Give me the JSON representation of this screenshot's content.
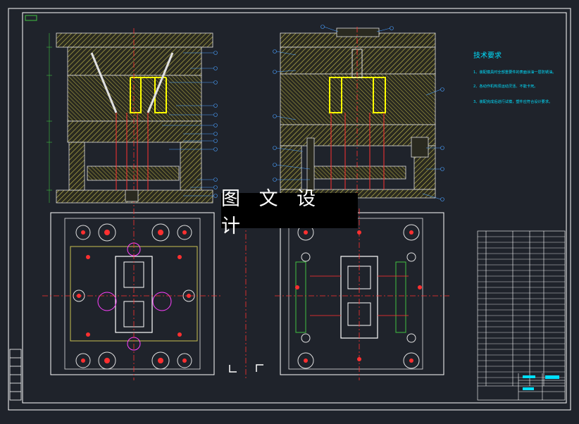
{
  "watermark": {
    "text": "图 文 设 计"
  },
  "tech_requirements": {
    "title": "技术要求",
    "lines": [
      "1、装配模具时全部重要件的表面涂油一层防锈油。",
      "2、各动作机构须运动灵活、不能卡死。",
      "3、装配完成后进行试模，塑件应符合设计要求。"
    ]
  },
  "colors": {
    "background": "#1f232b",
    "frame": "#ffffff",
    "hatch": "#c8c050",
    "core_yellow": "#ffff00",
    "callout": "#4aa0ff",
    "centerline": "#ff3030",
    "cyan_text": "#00e0ff",
    "magenta": "#ff40ff",
    "green": "#40c040"
  }
}
